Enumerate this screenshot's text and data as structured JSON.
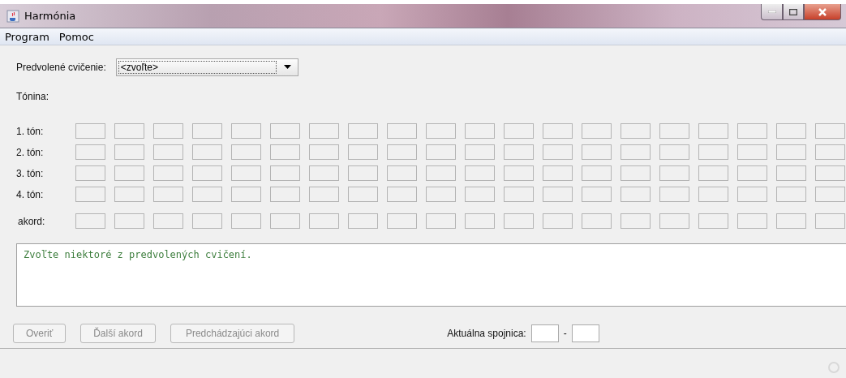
{
  "window": {
    "title": "Harmónia"
  },
  "menu": [
    {
      "label": "Program"
    },
    {
      "label": "Pomoc"
    }
  ],
  "exercise": {
    "label": "Predvolené cvičenie:",
    "value": "<zvoľte>"
  },
  "key": {
    "label": "Tónina:"
  },
  "grid": {
    "rows": [
      {
        "label": "1. tón:"
      },
      {
        "label": "2. tón:"
      },
      {
        "label": "3. tón:"
      },
      {
        "label": "4. tón:"
      },
      {
        "label": "akord:",
        "kind": "chord"
      }
    ]
  },
  "message": "Zvoľte niektoré z predvolených cvičení.",
  "buttons": [
    {
      "label": "Overiť",
      "disabled": true
    },
    {
      "label": "Ďalší akord",
      "disabled": true
    },
    {
      "label": "Predchádzajúci akord",
      "disabled": true
    }
  ],
  "connection": {
    "label": "Aktuálna spojnica:",
    "separator": "-"
  }
}
